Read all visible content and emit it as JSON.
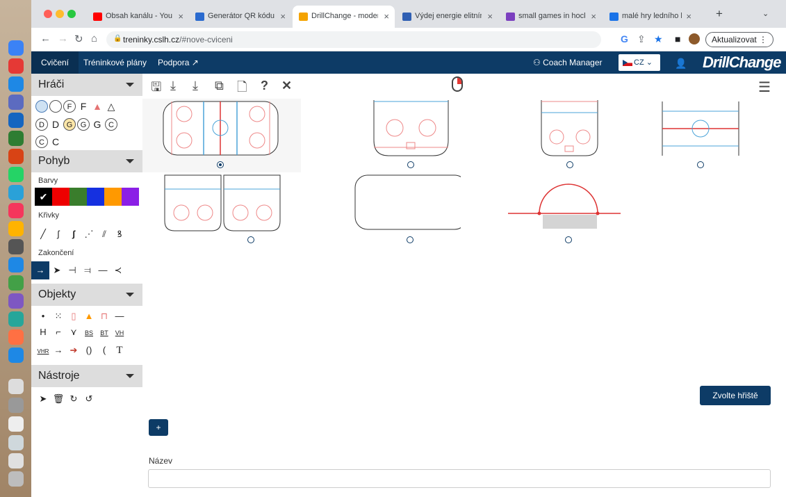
{
  "browser": {
    "tabs": [
      {
        "label": "Obsah kanálu - YouTube",
        "color": "#ff0000"
      },
      {
        "label": "Generátor QR kódu - V",
        "color": "#2a6acf"
      },
      {
        "label": "DrillChange - moderní",
        "color": "#f4a300"
      },
      {
        "label": "Výdej energie elitními",
        "color": "#2f5fb3"
      },
      {
        "label": "small games in hockey",
        "color": "#7b3fbf"
      },
      {
        "label": "malé hry ledního hokej",
        "color": "#1a73e8"
      }
    ],
    "url_host": "treninky.cslh.cz",
    "url_path": "/#nove-cviceni",
    "update_label": "Aktualizovat"
  },
  "nav": {
    "items": [
      "Cvičení",
      "Tréninkové plány",
      "Podpora"
    ],
    "coach": "Coach Manager",
    "lang": "CZ",
    "brand": "DrillChange"
  },
  "sidebar": {
    "players_title": "Hráči",
    "players_row1": [
      "F"
    ],
    "players_row2": [
      "D",
      "G",
      "C"
    ],
    "move_title": "Pohyb",
    "colors_label": "Barvy",
    "colors": [
      "#000000",
      "#ee0000",
      "#3a7d2c",
      "#1530e0",
      "#ff9900",
      "#8b1fe6"
    ],
    "curves_label": "Křivky",
    "endings_label": "Zakončení",
    "objects_title": "Objekty",
    "objects_row3": [
      "H",
      "BS",
      "BT",
      "VH"
    ],
    "objects_row4": [
      "VHR",
      "()",
      "(",
      "T"
    ],
    "tools_title": "Nástroje"
  },
  "main": {
    "choose_button": "Zvolte hřiště",
    "add_button": "+",
    "name_label": "Název"
  }
}
